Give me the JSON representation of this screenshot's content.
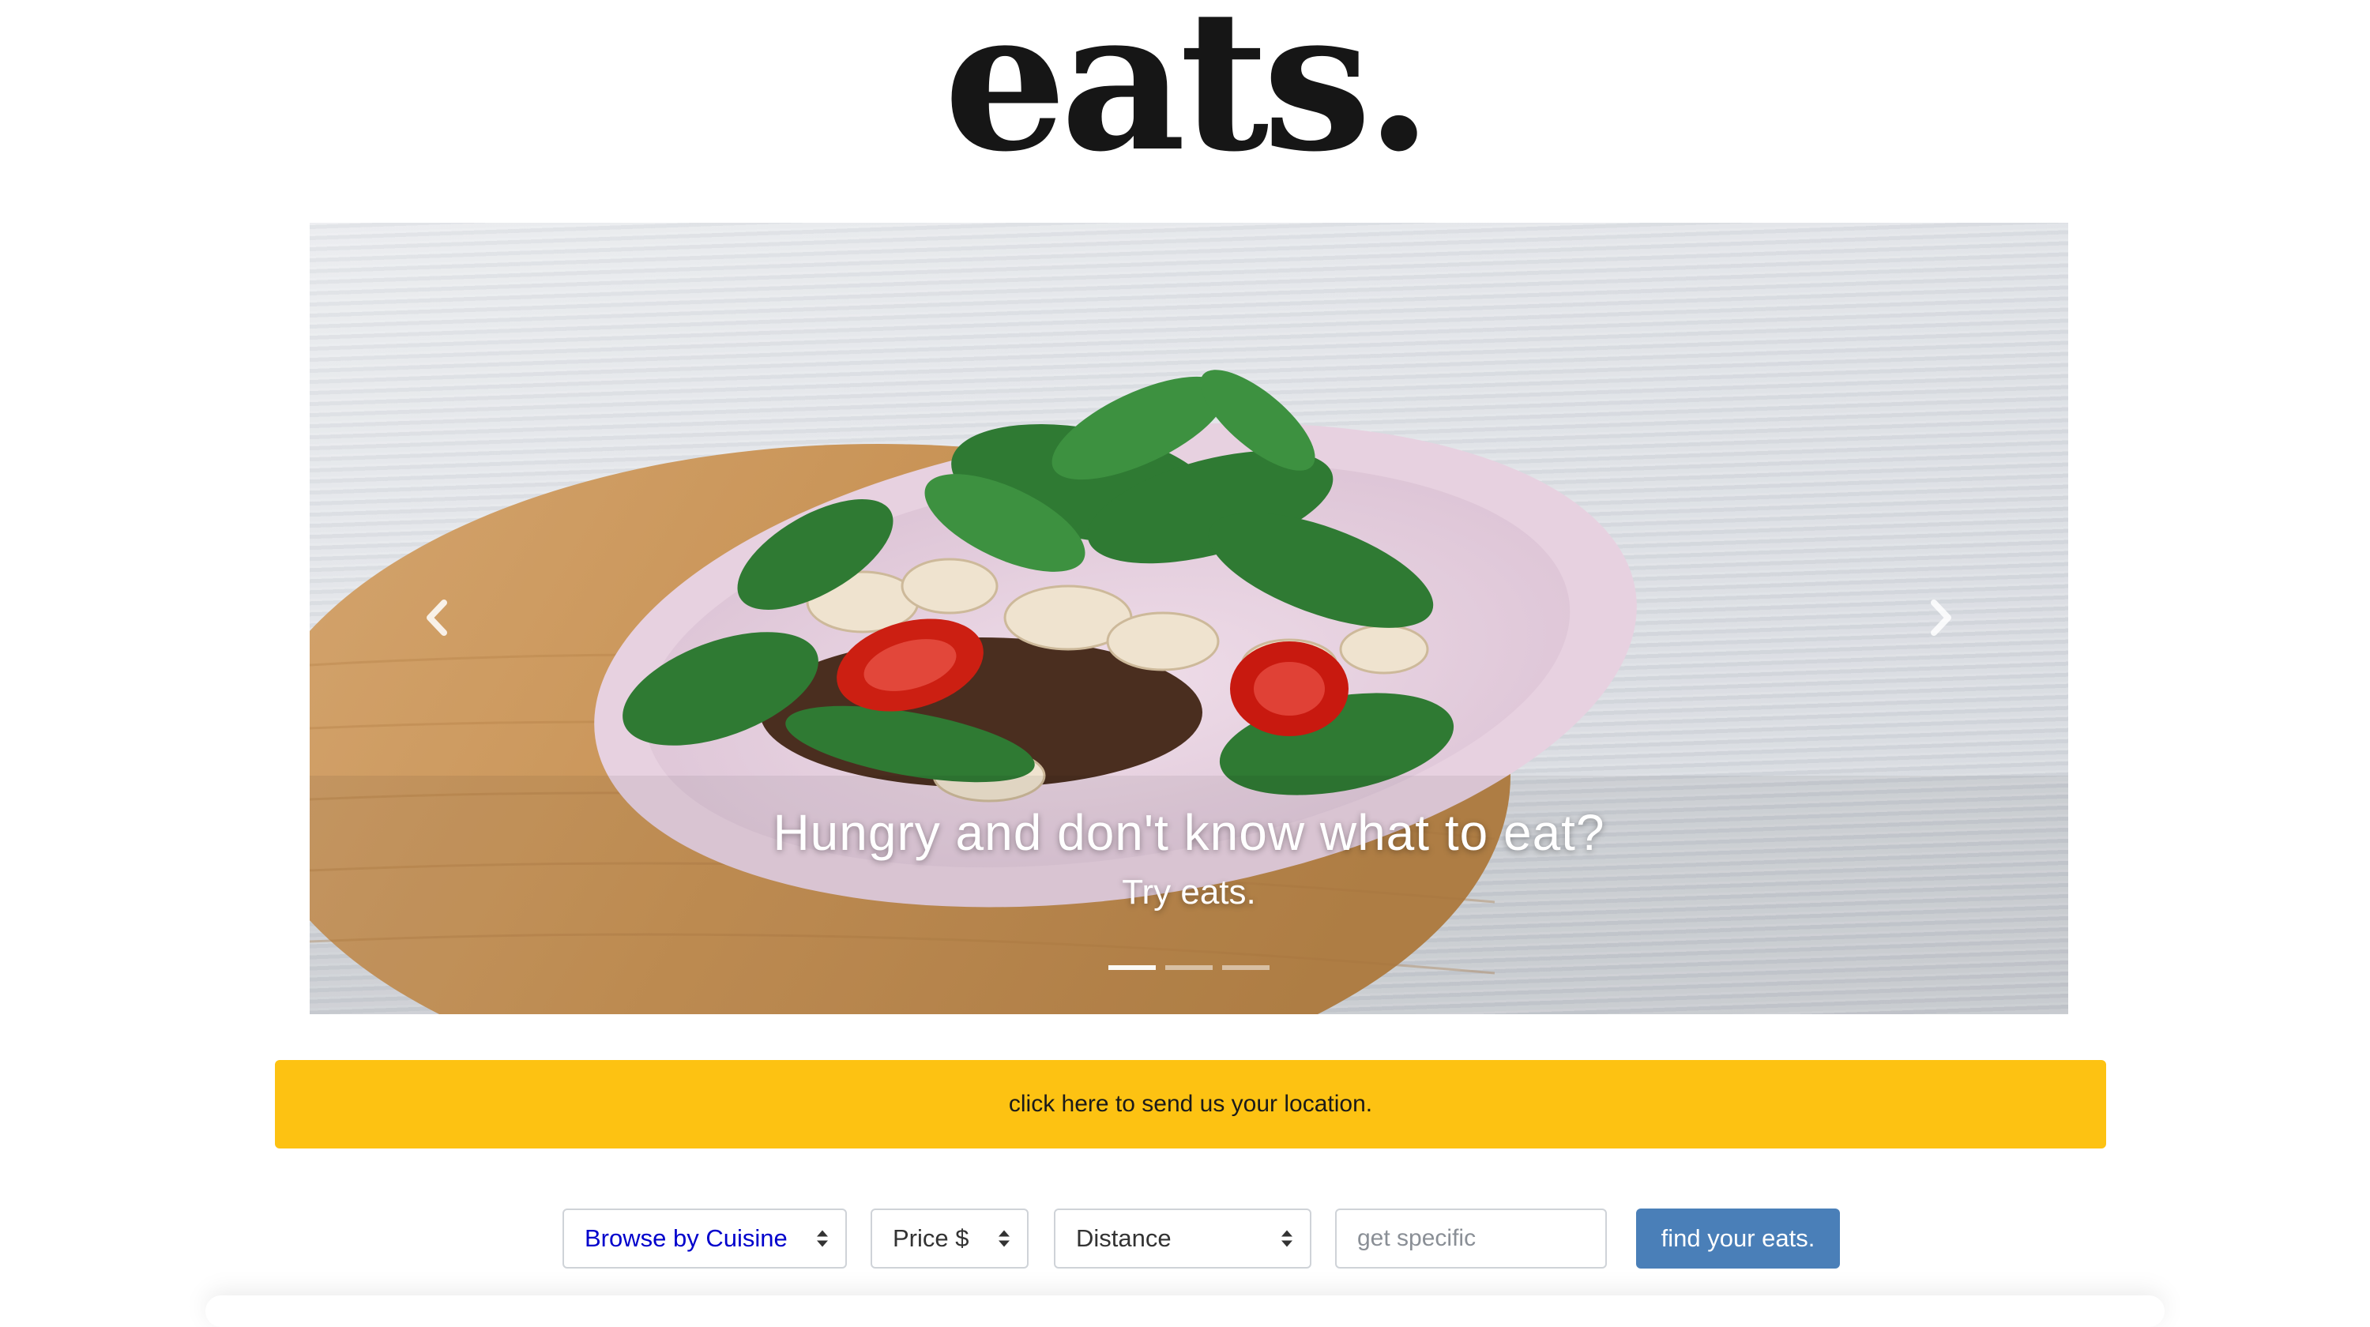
{
  "header": {
    "logo_text": "eats."
  },
  "carousel": {
    "caption_title": "Hungry and don't know what to eat?",
    "caption_subtitle": "Try eats.",
    "slide_count": 3,
    "active_slide": 1,
    "prev_icon": "chevron-left-icon",
    "next_icon": "chevron-right-icon",
    "image_subject": "bowl of spinach, mushrooms and tomatoes on toast over a wooden board"
  },
  "location_bar": {
    "label": "click here to send us your location.",
    "color": "#fdc212"
  },
  "filters": {
    "cuisine": {
      "selected": "Browse by Cuisine",
      "color": "#0000cc"
    },
    "price": {
      "selected": "Price $"
    },
    "distance": {
      "selected": "Distance"
    },
    "search": {
      "placeholder": "get specific",
      "value": ""
    },
    "submit": {
      "label": "find your eats.",
      "color": "#4a7fb8"
    }
  }
}
